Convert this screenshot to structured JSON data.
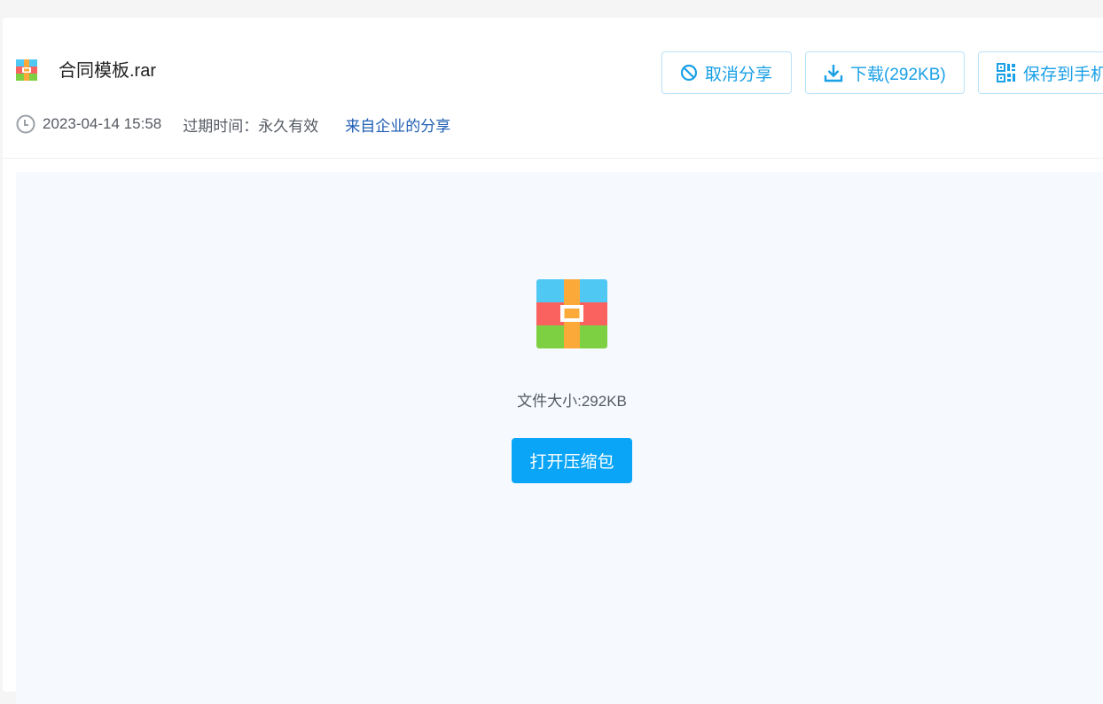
{
  "file": {
    "name": "合同模板.rar",
    "icon": "rar-archive-icon"
  },
  "meta": {
    "datetime": "2023-04-14 15:58",
    "expire_label": "过期时间：",
    "expire_value": "永久有效",
    "source": "来自企业的分享"
  },
  "actions": {
    "cancel_share": "取消分享",
    "download": "下载(292KB)",
    "save_to_phone": "保存到手机"
  },
  "preview": {
    "size_label": "文件大小:",
    "size_value": "292KB",
    "open_button": "打开压缩包"
  },
  "colors": {
    "accent": "#0aa5f7",
    "button_text": "#1aa0e6",
    "link": "#1f5fb3",
    "archive_blue": "#50c8f4",
    "archive_red": "#f9625e",
    "archive_green": "#7ed043",
    "archive_orange": "#fbaa3a"
  }
}
